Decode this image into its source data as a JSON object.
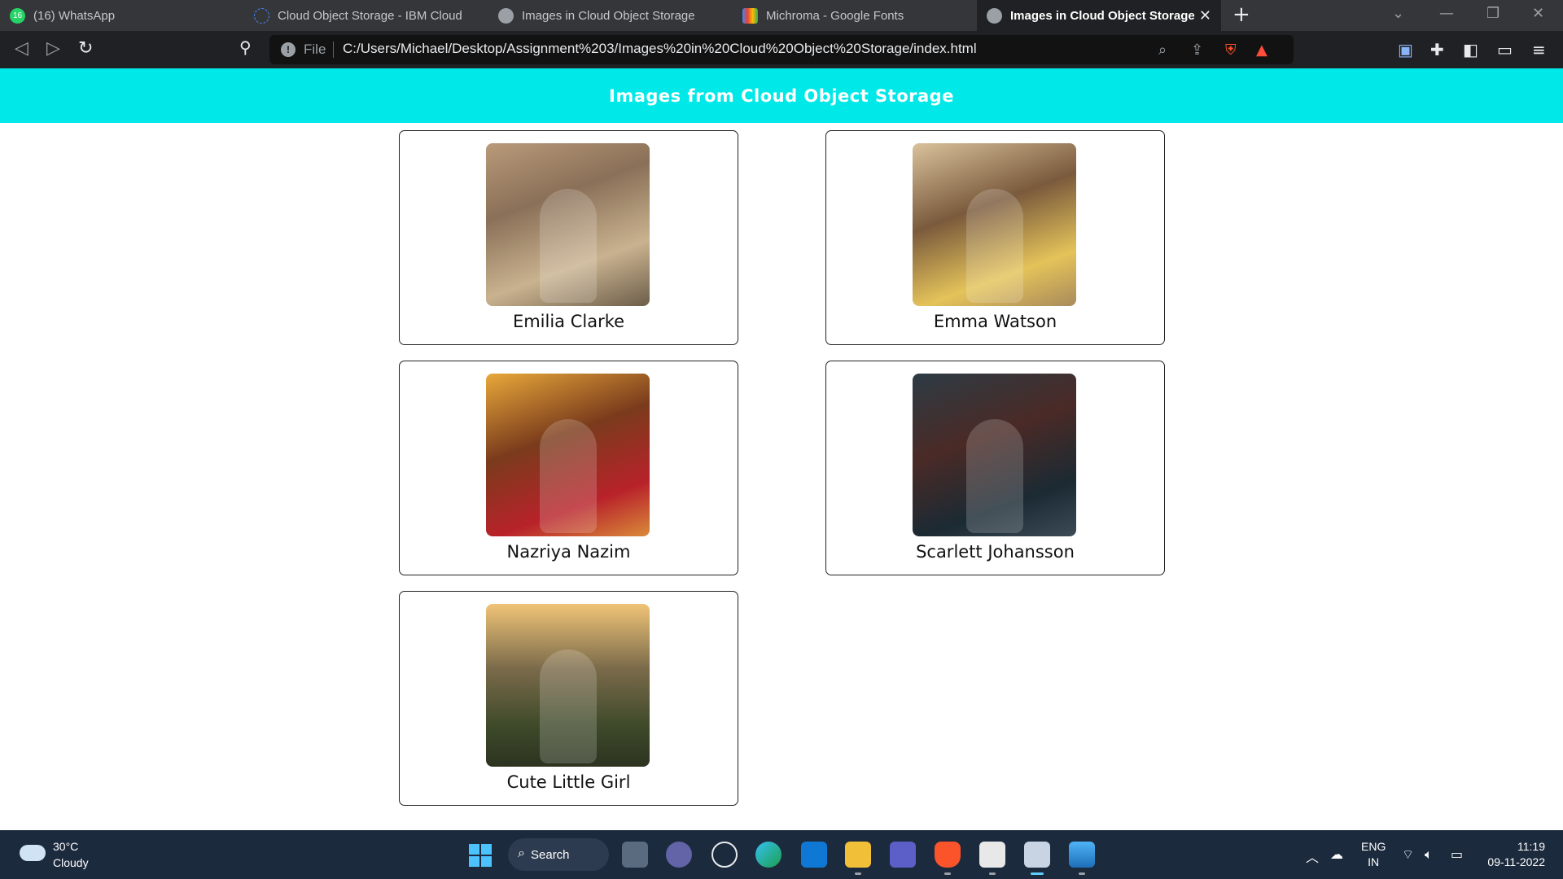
{
  "browser": {
    "tabs": [
      {
        "title": "(16) WhatsApp",
        "badge": "16"
      },
      {
        "title": "Cloud Object Storage - IBM Cloud"
      },
      {
        "title": "Images in Cloud Object Storage"
      },
      {
        "title": "Michroma - Google Fonts"
      },
      {
        "title": "Images in Cloud Object Storage",
        "active": true
      }
    ],
    "address": {
      "scheme": "File",
      "url": "C:/Users/Michael/Desktop/Assignment%203/Images%20in%20Cloud%20Object%20Storage/index.html"
    }
  },
  "page": {
    "header_title": "Images from Cloud Object Storage",
    "accent_color": "#00e8e8",
    "cards": [
      {
        "name": "Emilia Clarke"
      },
      {
        "name": "Emma Watson"
      },
      {
        "name": "Nazriya Nazim"
      },
      {
        "name": "Scarlett Johansson"
      },
      {
        "name": "Cute Little Girl"
      }
    ]
  },
  "taskbar": {
    "weather": {
      "temp": "30°C",
      "condition": "Cloudy"
    },
    "search_label": "Search",
    "language": {
      "line1": "ENG",
      "line2": "IN"
    },
    "clock": {
      "time": "11:19",
      "date": "09-11-2022"
    }
  }
}
